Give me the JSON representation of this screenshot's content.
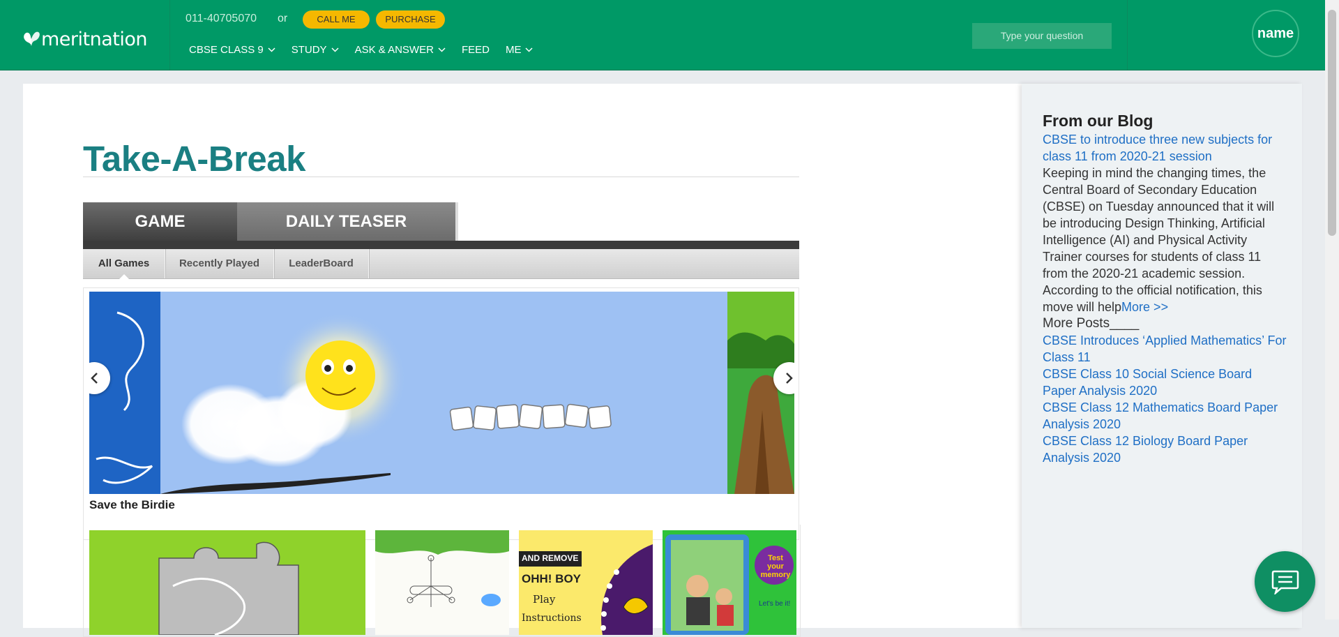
{
  "header": {
    "logo_text": "meritnation",
    "phone": "011-40705070",
    "or_text": "or",
    "call_label": "CALL ME",
    "purchase_label": "PURCHASE",
    "nav": [
      {
        "label": "CBSE CLASS 9",
        "dropdown": true
      },
      {
        "label": "STUDY",
        "dropdown": true
      },
      {
        "label": "ASK & ANSWER",
        "dropdown": true
      },
      {
        "label": "FEED",
        "dropdown": false
      },
      {
        "label": "ME",
        "dropdown": true
      }
    ],
    "search_placeholder": "Type your question",
    "avatar_alt": "name"
  },
  "main": {
    "title": "Take-A-Break",
    "tabs": [
      {
        "label": "GAME",
        "active": true
      },
      {
        "label": "DAILY TEASER",
        "active": false
      }
    ],
    "subtabs": [
      {
        "label": "All Games",
        "active": true
      },
      {
        "label": "Recently Played",
        "active": false
      },
      {
        "label": "LeaderBoard",
        "active": false
      }
    ],
    "featured_game": {
      "caption": "Save the Birdie"
    },
    "thumb_texts": {
      "t3_line1": "AND REMOVE",
      "t3_line2": "OHH! BOY",
      "t3_line3": "Play",
      "t3_line4": "Instructions",
      "t4_badge": "Test your memory",
      "t4_sub": "Let's be it!"
    }
  },
  "sidebar": {
    "heading": "From our Blog",
    "post_title": "CBSE to introduce three new subjects for class 11 from 2020-21 session",
    "post_excerpt": "Keeping in mind the changing times, the Central Board of Secondary Education (CBSE) on Tuesday announced that it will be introducing Design Thinking, Artificial Intelligence (AI) and Physical Activity Trainer courses for students of class 11 from the 2020-21 academic session. According to the official notification, this move will help",
    "more_label": "More >>",
    "more_posts_label": "More Posts____",
    "posts": [
      "CBSE Introduces ‘Applied Mathematics’ For Class 11",
      "CBSE Class 10 Social Science Board Paper Analysis 2020",
      "CBSE Class 12 Mathematics Board Paper Analysis 2020",
      "CBSE Class 12 Biology Board Paper Analysis 2020"
    ]
  },
  "colors": {
    "brand_green": "#009966",
    "accent_yellow": "#f5b800",
    "title_teal": "#1a7f82",
    "link_blue": "#1f6fc5"
  },
  "icons": [
    "butterfly-logo-icon",
    "chevron-down-icon",
    "chevron-left-icon",
    "chevron-right-icon",
    "chat-icon"
  ]
}
